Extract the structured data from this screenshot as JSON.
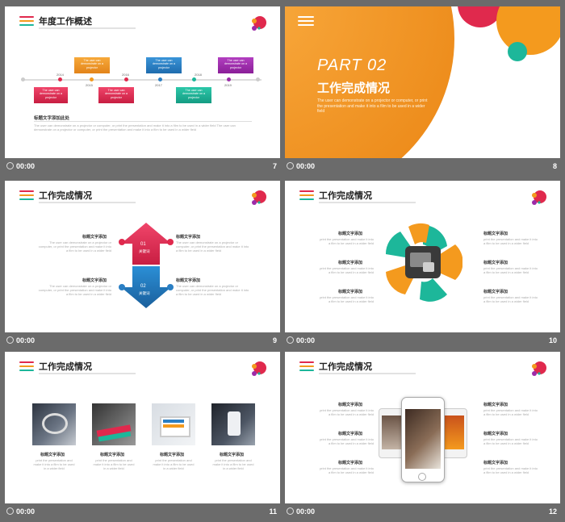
{
  "slides": [
    {
      "num": "7",
      "time": "00:00",
      "title": "年度工作概述",
      "years": [
        "2014",
        "2015",
        "2016",
        "2017",
        "2018",
        "2019"
      ],
      "box_text": "The user can demonstrate on a projector",
      "heading": "标题文字添加此处",
      "body": "The user can demonstrate on a projector or computer, or print the presentation and make it into a film to be used in a wider field The user can demonstrate on a projector or computer, or print the presentation and make it into a film to be used in a wider field"
    },
    {
      "num": "8",
      "time": "00:00",
      "part": "PART 02",
      "title": "工作完成情况",
      "body": "The user can demonstrate on a projector or computer, or print the presentation and make it into a film to be used in a wider field"
    },
    {
      "num": "9",
      "time": "00:00",
      "title": "工作完成情况",
      "labels": [
        "标题文字添加",
        "标题文字添加",
        "标题文字添加",
        "标题文字添加"
      ],
      "body": "The user can demonstrate on a projector or computer, or print the presentation and make it into a film to be used in a wider field",
      "arrow_num": [
        "01",
        "02"
      ],
      "arrow_kw": [
        "关键词",
        "关键词"
      ]
    },
    {
      "num": "10",
      "time": "00:00",
      "title": "工作完成情况",
      "labels": [
        "标题文字添加",
        "标题文字添加",
        "标题文字添加",
        "标题文字添加",
        "标题文字添加",
        "标题文字添加"
      ],
      "body": "print the presentation and make it into a film to be used in a wider field"
    },
    {
      "num": "11",
      "time": "00:00",
      "title": "工作完成情况",
      "labels": [
        "标题文字添加",
        "标题文字添加",
        "标题文字添加",
        "标题文字添加"
      ],
      "body": "print the presentation and make it into a film to be used in a wider field"
    },
    {
      "num": "12",
      "time": "00:00",
      "title": "工作完成情况",
      "labels": [
        "标题文字添加",
        "标题文字添加",
        "标题文字添加",
        "标题文字添加",
        "标题文字添加",
        "标题文字添加"
      ],
      "body": "print the presentation and make it into a film to be used in a wider field"
    }
  ],
  "colors": {
    "red": "#e0294d",
    "orange": "#f49a1e",
    "teal": "#1db79a",
    "blue": "#2b7fc4",
    "purple": "#9c2ba8",
    "bg": "#6b6b6b"
  }
}
